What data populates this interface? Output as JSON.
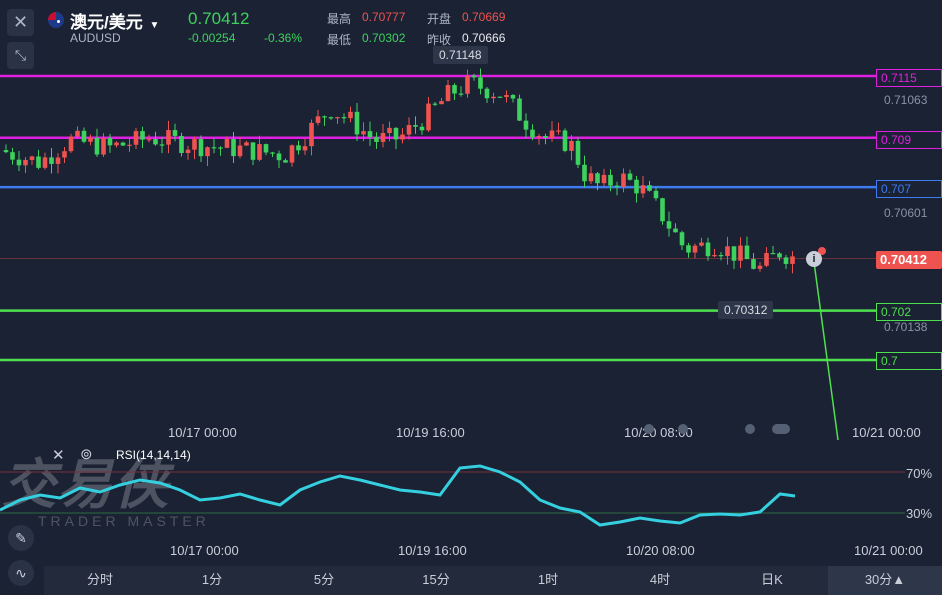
{
  "header": {
    "title": "澳元/美元",
    "symbol": "AUDUSD",
    "price": "0.70412",
    "change": "-0.00254",
    "change_pct": "-0.36%",
    "stats": {
      "high_label": "最高",
      "high": "0.70777",
      "open_label": "开盘",
      "open": "0.70669",
      "low_label": "最低",
      "low": "0.70302",
      "prev_label": "昨收",
      "prev": "0.70666"
    }
  },
  "price_axis": {
    "labels": [
      "0.71063",
      "0.70601",
      "0.70138"
    ],
    "current_tag": "0.70412"
  },
  "lines": [
    {
      "value": "0.7115",
      "color": "#e020e0"
    },
    {
      "value": "0.709",
      "color": "#e020e0"
    },
    {
      "value": "0.707",
      "color": "#3d7bf0"
    },
    {
      "value": "0.702",
      "color": "#4fe04f"
    },
    {
      "value": "0.7",
      "color": "#4fe04f"
    }
  ],
  "tooltips": {
    "high_marker": "0.71148",
    "low_marker": "0.70312"
  },
  "time_axis": [
    "10/17 00:00",
    "10/19 16:00",
    "10/20 08:00",
    "10/21 00:00"
  ],
  "rsi": {
    "label": "RSI(14,14,14)",
    "levels": [
      "70%",
      "30%"
    ],
    "time_axis": [
      "10/17 00:00",
      "10/19 16:00",
      "10/20 08:00",
      "10/21 00:00"
    ]
  },
  "watermark": {
    "cn": "交易侠",
    "en": "TRADER MASTER"
  },
  "tabs": [
    "分时",
    "1分",
    "5分",
    "15分",
    "1时",
    "4时",
    "日K",
    "30分▲"
  ],
  "active_tab": "30分▲",
  "colors": {
    "up": "#ef5350",
    "down": "#3dd25e",
    "rsi": "#35d0e0",
    "bg": "#1b2233"
  }
}
